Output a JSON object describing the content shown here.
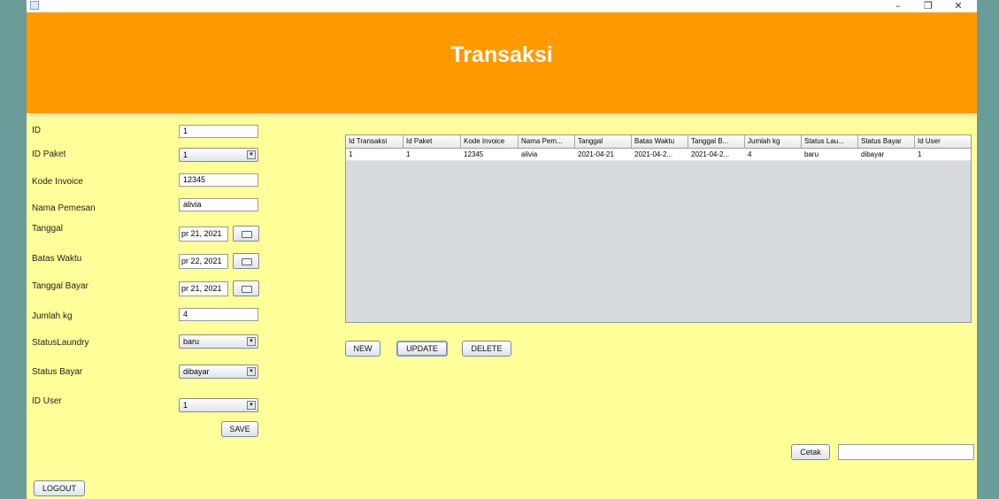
{
  "window": {
    "minimize_glyph": "–",
    "restore_glyph": "❐",
    "close_glyph": "✕"
  },
  "header": {
    "title": "Transaksi"
  },
  "form": {
    "id_label": "ID",
    "id_value": "1",
    "id_paket_label": "ID Paket",
    "id_paket_value": "1",
    "kode_invoice_label": "Kode Invoice",
    "kode_invoice_value": "12345",
    "nama_pemesan_label": "Nama Pemesan",
    "nama_pemesan_value": "alivia",
    "tanggal_label": "Tanggal",
    "tanggal_value": "pr 21, 2021",
    "batas_waktu_label": "Batas Waktu",
    "batas_waktu_value": "pr 22, 2021",
    "tanggal_bayar_label": "Tanggal Bayar",
    "tanggal_bayar_value": "pr 21, 2021",
    "jumlah_kg_label": "Jumlah kg",
    "jumlah_kg_value": "4",
    "status_laundry_label": "StatusLaundry",
    "status_laundry_value": "baru",
    "status_bayar_label": "Status Bayar",
    "status_bayar_value": "dibayar",
    "id_user_label": "ID User",
    "id_user_value": "1",
    "save_label": "SAVE",
    "combo_arrow": "▼"
  },
  "table": {
    "columns": [
      "Id Transaksi",
      "Id Paket",
      "Kode Invoice",
      "Nama Pem...",
      "Tanggal",
      "Batas Waktu",
      "Tanggal B...",
      "Jumlah kg",
      "Status Lau...",
      "Status Bayar",
      "Id User"
    ],
    "rows": [
      [
        "1",
        "1",
        "12345",
        "alivia",
        "2021-04-21",
        "2021-04-2...",
        "2021-04-2...",
        "4",
        "baru",
        "dibayar",
        "1"
      ]
    ]
  },
  "actions": {
    "new_label": "NEW",
    "update_label": "UPDATE",
    "delete_label": "DELETE",
    "cetak_label": "Cetak",
    "cetak_value": "",
    "logout_label": "LOGOUT"
  },
  "colors": {
    "header_bg": "#ff9900",
    "content_bg": "#ffff99",
    "outer_bg": "#6a9c9a"
  }
}
